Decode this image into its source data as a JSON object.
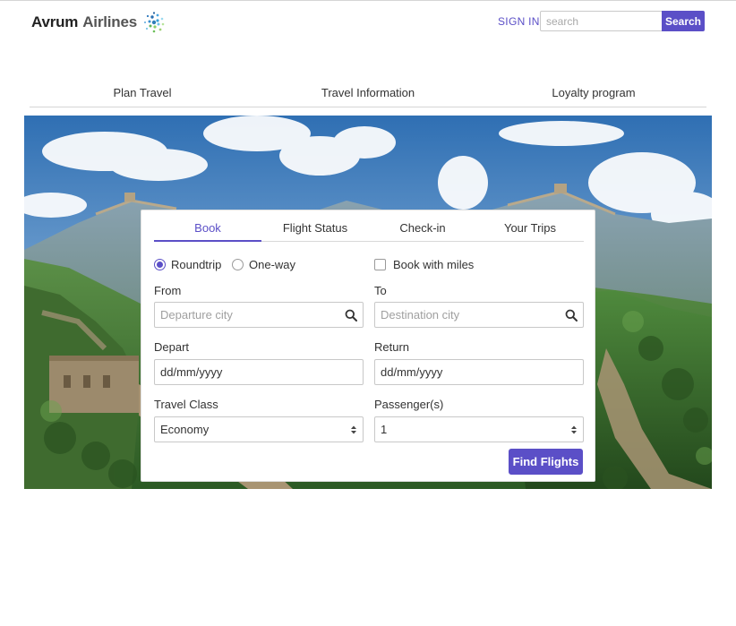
{
  "brand": {
    "name_first": "Avrum",
    "name_second": "Airlines",
    "accent_color": "#5b4fc7",
    "logo_icon": "dotted-spiral-logo"
  },
  "header": {
    "sign_in_label": "SIGN IN",
    "search_placeholder": "search",
    "search_button_label": "Search"
  },
  "main_nav": {
    "items": [
      {
        "label": "Plan Travel"
      },
      {
        "label": "Travel Information"
      },
      {
        "label": "Loyalty program"
      }
    ]
  },
  "hero": {
    "image_subject": "Great Wall of China on green mountains under blue sky"
  },
  "booking": {
    "tabs": [
      {
        "label": "Book",
        "active": true
      },
      {
        "label": "Flight Status",
        "active": false
      },
      {
        "label": "Check-in",
        "active": false
      },
      {
        "label": "Your Trips",
        "active": false
      }
    ],
    "trip_type": {
      "roundtrip_label": "Roundtrip",
      "oneway_label": "One-way",
      "selected": "Roundtrip"
    },
    "book_with_miles": {
      "label": "Book with miles",
      "checked": false
    },
    "from": {
      "label": "From",
      "placeholder": "Departure city",
      "value": ""
    },
    "to": {
      "label": "To",
      "placeholder": "Destination city",
      "value": ""
    },
    "depart": {
      "label": "Depart",
      "value": "dd/mm/yyyy"
    },
    "return": {
      "label": "Return",
      "value": "dd/mm/yyyy"
    },
    "travel_class": {
      "label": "Travel Class",
      "selected": "Economy"
    },
    "passengers": {
      "label": "Passenger(s)",
      "selected": "1"
    },
    "submit_label": "Find Flights"
  }
}
